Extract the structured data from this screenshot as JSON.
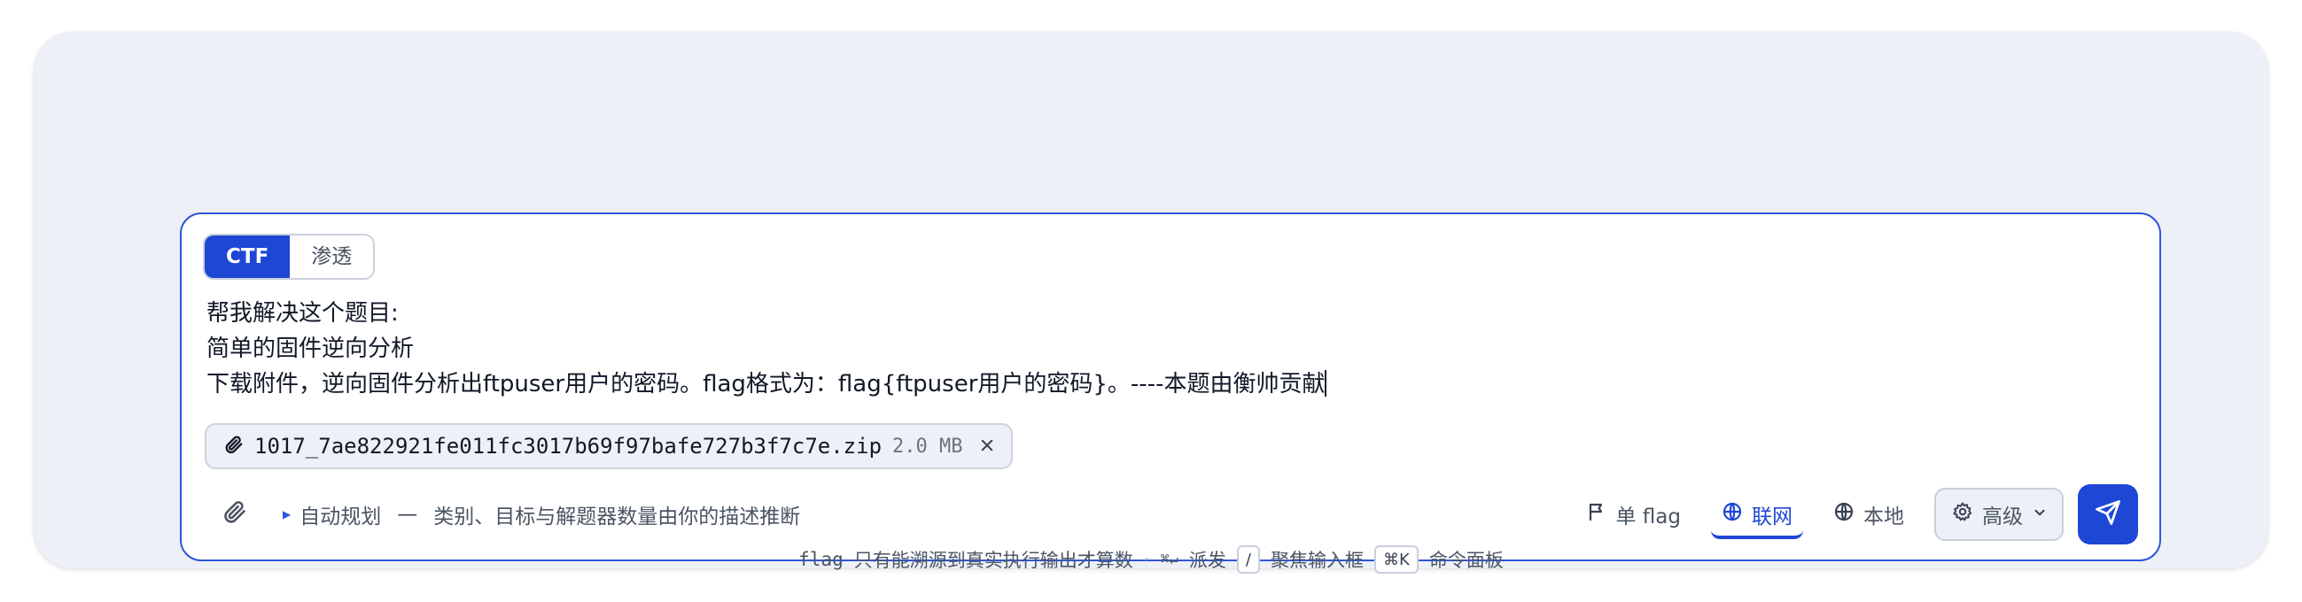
{
  "mode": {
    "options": [
      "CTF",
      "渗透"
    ],
    "active": "CTF"
  },
  "prompt": {
    "lines": [
      "帮我解决这个题目:",
      "简单的固件逆向分析",
      "下载附件，逆向固件分析出ftpuser用户的密码。flag格式为：flag{ftpuser用户的密码}。----本题由衡帅贡献"
    ]
  },
  "attachment": {
    "filename": "1017_7ae822921fe011fc3017b69f97bafe727b3f7c7e.zip",
    "size": "2.0 MB",
    "icon": "paperclip-icon",
    "remove_icon": "close-icon"
  },
  "toolbar": {
    "attach_icon": "paperclip-icon",
    "plan_label": "自动规划",
    "plan_dash": "—",
    "plan_desc": "类别、目标与解题器数量由你的描述推断",
    "flag_label": "单 flag",
    "online_label": "联网",
    "local_label": "本地",
    "advanced_label": "高级",
    "send_icon": "send-icon"
  },
  "footer": {
    "note_mono": "flag",
    "note": "只有能溯源到真实执行输出才算数",
    "dot": "·",
    "dispatch_key": "⌘↵",
    "dispatch_label": "派发",
    "focus_key": "/",
    "focus_label": "聚焦输入框",
    "palette_key": "⌘K",
    "palette_label": "命令面板"
  },
  "colors": {
    "accent": "#1e47d6",
    "background": "#eef0f7"
  }
}
